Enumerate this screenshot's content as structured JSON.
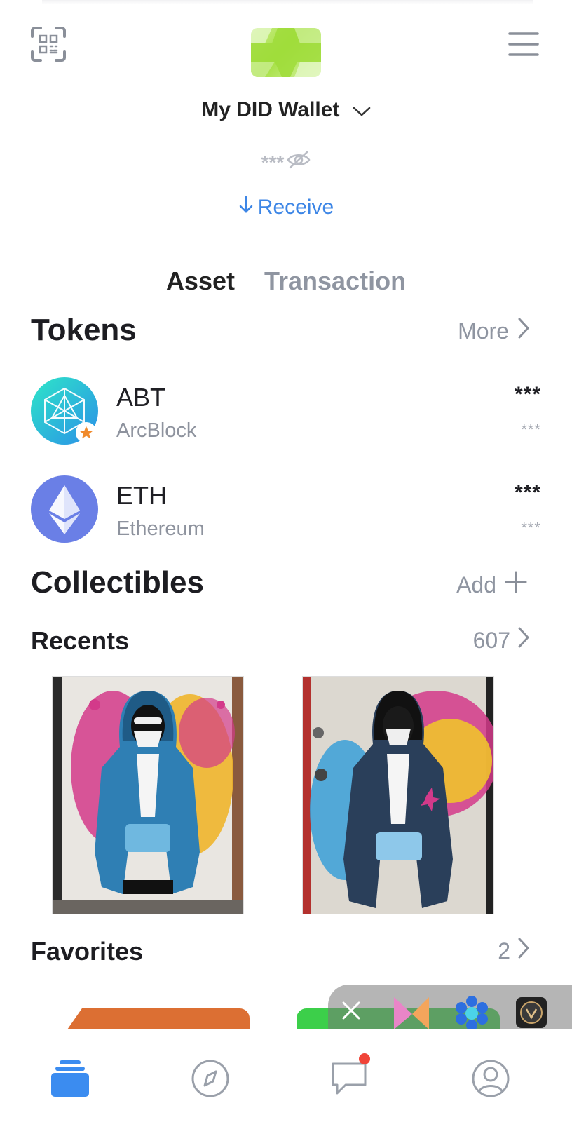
{
  "header": {
    "wallet_name": "My DID Wallet",
    "balance_masked": "***"
  },
  "actions": {
    "receive_label": "Receive"
  },
  "tabs": [
    {
      "label": "Asset",
      "active": true
    },
    {
      "label": "Transaction",
      "active": false
    }
  ],
  "tokens": {
    "title": "Tokens",
    "more_label": "More",
    "items": [
      {
        "symbol": "ABT",
        "name": "ArcBlock",
        "balance": "***",
        "fiat": "***"
      },
      {
        "symbol": "ETH",
        "name": "Ethereum",
        "balance": "***",
        "fiat": "***"
      }
    ]
  },
  "collectibles": {
    "title": "Collectibles",
    "add_label": "Add",
    "recents": {
      "title": "Recents",
      "count": "607"
    },
    "favorites": {
      "title": "Favorites",
      "count": "2"
    }
  },
  "colors": {
    "accent_blue": "#3d86e6",
    "nav_active": "#3b8cf0",
    "notification_dot": "#f04438",
    "abt_gradient": [
      "#2ee6c8",
      "#2b8fe8"
    ],
    "eth_bg": "#6a7fe6"
  },
  "icons": {
    "scan": "qr-scan-icon",
    "menu": "hamburger-menu-icon",
    "nav": [
      "wallet-icon",
      "compass-icon",
      "chat-icon",
      "profile-icon"
    ]
  }
}
